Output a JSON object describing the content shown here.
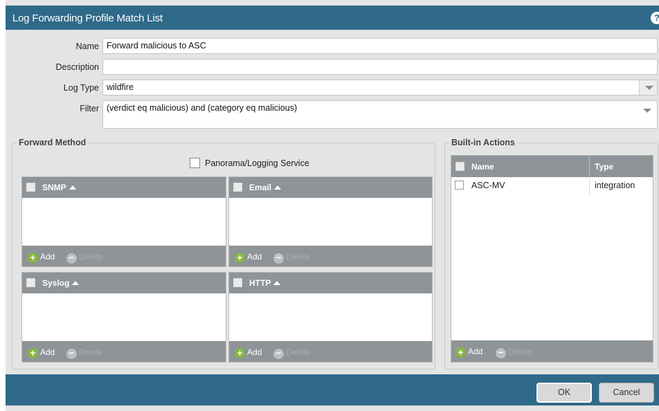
{
  "dialog": {
    "title": "Log Forwarding Profile Match List",
    "help_icon": "?"
  },
  "form": {
    "name_label": "Name",
    "name_value": "Forward malicious to ASC",
    "description_label": "Description",
    "description_value": "",
    "log_type_label": "Log Type",
    "log_type_value": "wildfire",
    "filter_label": "Filter",
    "filter_value": "(verdict eq malicious) and (category eq malicious)"
  },
  "forward_method": {
    "legend": "Forward Method",
    "panorama_label": "Panorama/Logging Service",
    "panels": [
      {
        "header": "SNMP"
      },
      {
        "header": "Email"
      },
      {
        "header": "Syslog"
      },
      {
        "header": "HTTP"
      }
    ],
    "add_label": "Add",
    "delete_label": "Delete"
  },
  "builtin_actions": {
    "legend": "Built-in Actions",
    "columns": [
      "Name",
      "Type"
    ],
    "rows": [
      {
        "name": "ASC-MV",
        "type": "integration"
      }
    ],
    "add_label": "Add",
    "delete_label": "Delete"
  },
  "footer": {
    "ok_label": "OK",
    "cancel_label": "Cancel"
  },
  "colors": {
    "titlebar": "#2f6a8a",
    "panel_header": "#8e9498",
    "add_green": "#84b740"
  }
}
